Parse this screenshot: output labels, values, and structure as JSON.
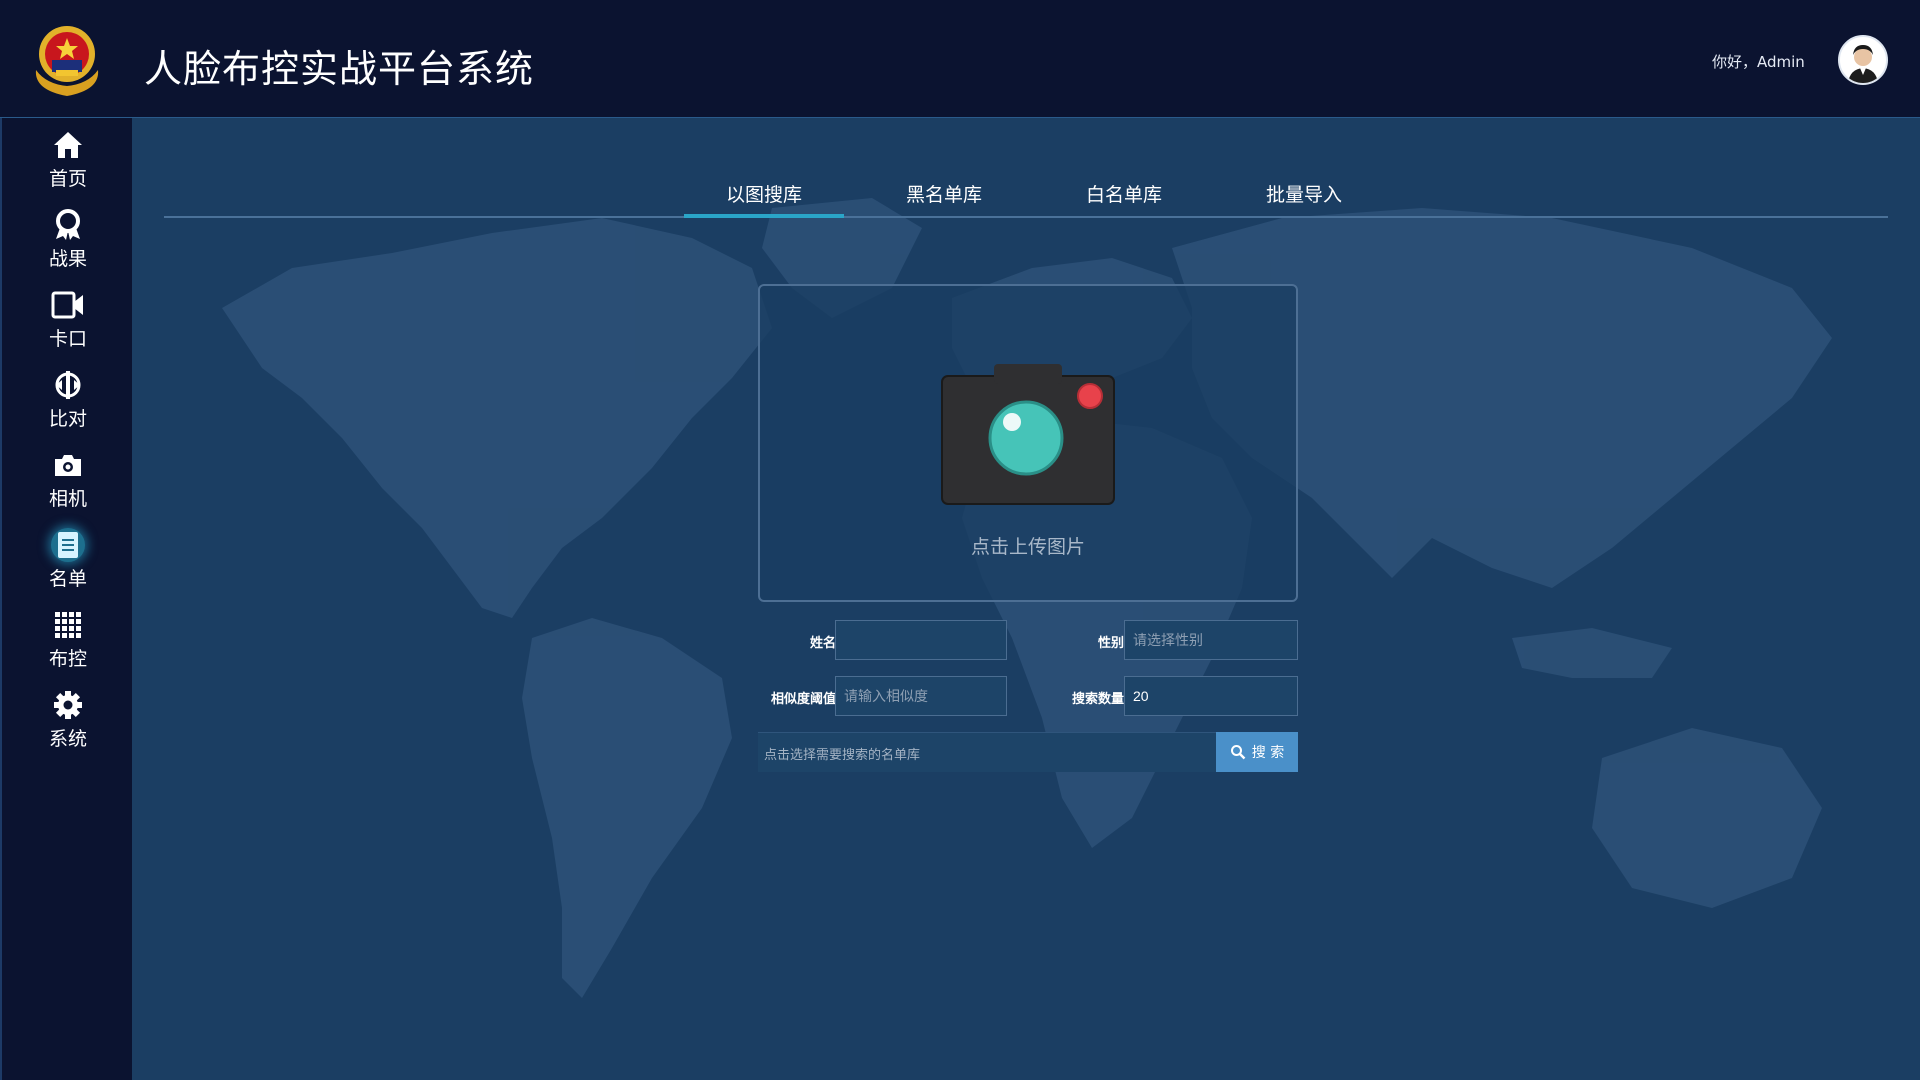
{
  "header": {
    "title": "人脸布控实战平台系统",
    "greeting": "你好，Admin",
    "emblem_icon": "police-emblem-icon",
    "avatar_icon": "user-avatar"
  },
  "sidebar": {
    "items": [
      {
        "label": "首页",
        "icon": "home-icon"
      },
      {
        "label": "战果",
        "icon": "award-icon"
      },
      {
        "label": "卡口",
        "icon": "video-camera-icon"
      },
      {
        "label": "比对",
        "icon": "compare-icon"
      },
      {
        "label": "相机",
        "icon": "camera-icon"
      },
      {
        "label": "名单",
        "icon": "document-icon",
        "active": true
      },
      {
        "label": "布控",
        "icon": "grid-icon"
      },
      {
        "label": "系统",
        "icon": "gear-icon"
      }
    ]
  },
  "tabs": [
    {
      "label": "以图搜库",
      "active": true
    },
    {
      "label": "黑名单库"
    },
    {
      "label": "白名单库"
    },
    {
      "label": "批量导入"
    }
  ],
  "upload": {
    "label": "点击上传图片",
    "icon": "camera-upload-icon"
  },
  "form": {
    "name_label": "姓名",
    "name_value": "",
    "gender_label": "性别",
    "gender_placeholder": "请选择性别",
    "similarity_label": "相似度阈值",
    "similarity_placeholder": "请输入相似度",
    "count_label": "搜索数量",
    "count_value": "20",
    "library_hint": "点击选择需要搜索的名单库",
    "search_label": "搜 索",
    "search_icon": "search-icon"
  },
  "colors": {
    "header_bg": "#0b1330",
    "main_bg": "#1b3e63",
    "accent": "#2aa5c8",
    "button": "#4a90c9"
  }
}
